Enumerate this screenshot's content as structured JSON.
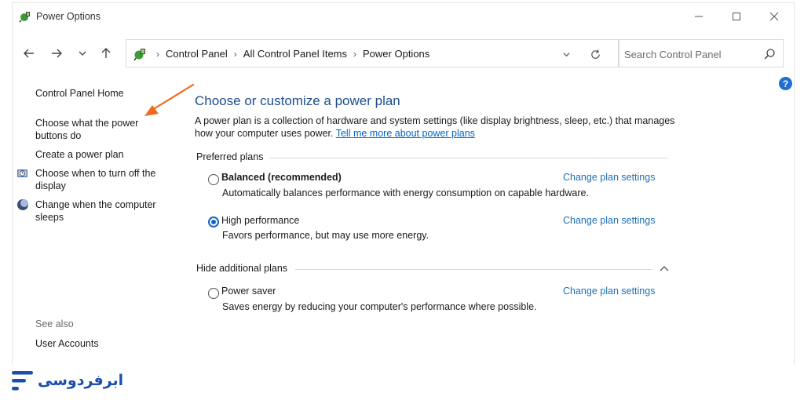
{
  "window": {
    "title": "Power Options"
  },
  "address_bar": {
    "crumbs": [
      "Control Panel",
      "All Control Panel Items",
      "Power Options"
    ]
  },
  "search": {
    "placeholder": "Search Control Panel"
  },
  "help": {
    "label": "?"
  },
  "sidebar": {
    "home": "Control Panel Home",
    "power_buttons": "Choose what the power buttons do",
    "create_plan": "Create a power plan",
    "turn_off_display": "Choose when to turn off the display",
    "computer_sleeps": "Change when the computer sleeps",
    "see_also": "See also",
    "user_accounts": "User Accounts"
  },
  "main": {
    "heading": "Choose or customize a power plan",
    "description": "A power plan is a collection of hardware and system settings (like display brightness, sleep, etc.) that manages how your computer uses power.",
    "learn_more": "Tell me more about power plans",
    "preferred_title": "Preferred plans",
    "hidden_title": "Hide additional plans",
    "plans": [
      {
        "name": "Balanced (recommended)",
        "description": "Automatically balances performance with energy consumption on capable hardware.",
        "link": "Change plan settings",
        "selected": false
      },
      {
        "name": "High performance",
        "description": "Favors performance, but may use more energy.",
        "link": "Change plan settings",
        "selected": true
      },
      {
        "name": "Power saver",
        "description": "Saves energy by reducing your computer's performance where possible.",
        "link": "Change plan settings",
        "selected": false
      }
    ]
  },
  "annotation": {
    "arrow_color": "#f26a1b"
  },
  "brand": {
    "text": "ابرفردوسی",
    "color": "#1a4fb0"
  },
  "colors": {
    "heading": "#1e4e8c",
    "link": "#1e6fb8",
    "radio_selected": "#1565c0"
  }
}
